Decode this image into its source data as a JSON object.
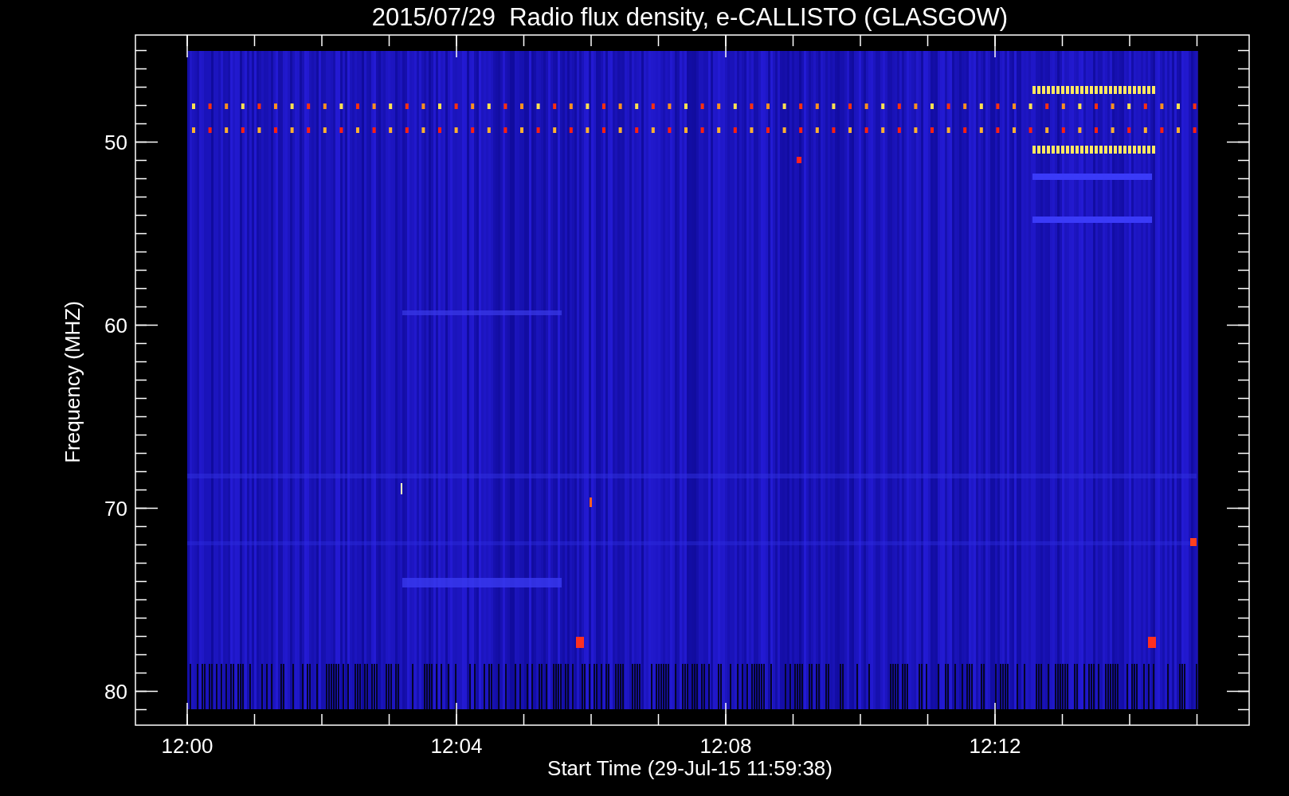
{
  "title": "2015/07/29  Radio flux density, e-CALLISTO (GLASGOW)",
  "y_axis": {
    "label": "Frequency (MHZ)",
    "ticks": [
      "50",
      "60",
      "70",
      "80"
    ]
  },
  "x_axis": {
    "label": "Start Time (29-Jul-15 11:59:38)",
    "ticks": [
      "12:00",
      "12:04",
      "12:08",
      "12:12"
    ]
  }
}
